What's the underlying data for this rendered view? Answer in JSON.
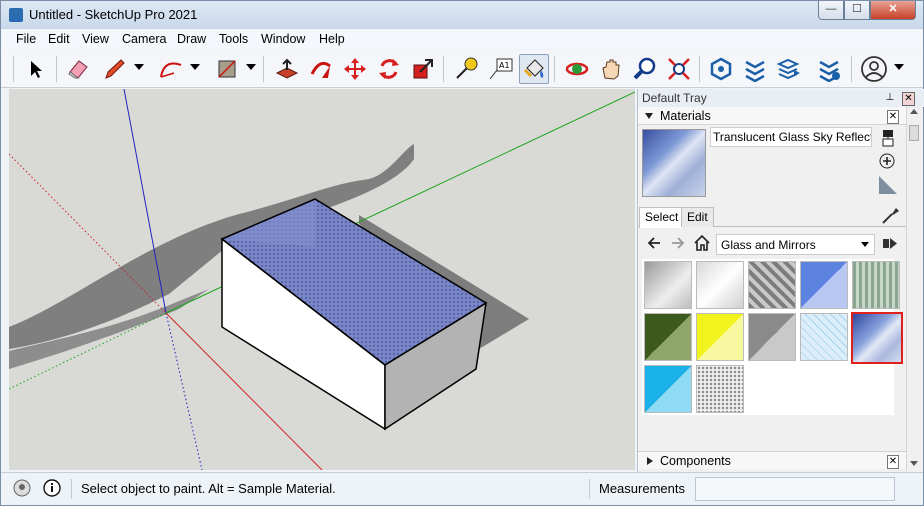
{
  "window": {
    "title": "Untitled - SketchUp Pro 2021",
    "min": "—",
    "max": "☐",
    "close": "✕"
  },
  "menu": [
    "File",
    "Edit",
    "View",
    "Camera",
    "Draw",
    "Tools",
    "Window",
    "Help"
  ],
  "toolbar": {
    "icons": [
      "select-icon",
      "eraser-icon",
      "pencil-icon",
      "arc-icon",
      "rectangle-icon",
      "push-pull-icon",
      "follow-me-icon",
      "move-icon",
      "rotate-icon",
      "scale-icon",
      "tape-measure-icon",
      "text-icon",
      "paint-bucket-icon",
      "orbit-icon",
      "pan-icon",
      "zoom-icon",
      "zoom-extents-icon",
      "extension-warehouse-icon",
      "3d-warehouse-icon",
      "layout-icon",
      "extension-manager-icon",
      "account-icon"
    ],
    "text_label": "A1",
    "active": "paint-bucket-icon"
  },
  "tray": {
    "title": "Default Tray",
    "pin": "⊥",
    "close": "✕",
    "materials": {
      "header": "Materials",
      "name": "Translucent Glass Sky Reflection",
      "tabs": [
        "Select",
        "Edit"
      ],
      "active_tab": "Select",
      "collection": "Glass and Mirrors",
      "selected_index": 9
    },
    "components": {
      "header": "Components"
    }
  },
  "swatches": [
    {
      "name": "swatch-glass-gray-gradient",
      "style": "linear-gradient(135deg,#9a9a9a,#eeeeee 60%,#bdbdbd)"
    },
    {
      "name": "swatch-glass-silver",
      "style": "linear-gradient(135deg,#d8d8d8,#ffffff 50%,#cfcfcf)"
    },
    {
      "name": "swatch-glass-block",
      "style": "repeating-linear-gradient(45deg,#7d7d7d 0 4px,#c9c9c9 4px 8px)"
    },
    {
      "name": "swatch-glass-blue",
      "style": "linear-gradient(135deg,#5c83e0 50%,#b8c8f2 50%)"
    },
    {
      "name": "swatch-glass-green-ribbed",
      "style": "repeating-linear-gradient(90deg,#8aa690 0 3px,#c7d8c9 3px 6px)"
    },
    {
      "name": "swatch-glass-dark-green",
      "style": "linear-gradient(135deg,#3c5a1c 50%,#8ea66a 50%)"
    },
    {
      "name": "swatch-glass-yellow",
      "style": "linear-gradient(135deg,#f2f21c 50%,#f8f8a0 50%)"
    },
    {
      "name": "swatch-glass-gray-tint",
      "style": "linear-gradient(135deg,#8a8a8a 50%,#c9c9c9 50%)"
    },
    {
      "name": "swatch-glass-light-blue-grid",
      "style": "repeating-linear-gradient(45deg,#dbeefa 0 5px,#a8d2ee 5px 6px)"
    },
    {
      "name": "swatch-translucent-glass-sky-reflection",
      "style": "linear-gradient(135deg,#2f45a0 0%,#8aa3dc 40%,#e2e8f6 55%,#aab9dd 75%,#d3dcef 100%)"
    },
    {
      "name": "swatch-glass-cyan",
      "style": "linear-gradient(135deg,#1ab0e8 50%,#8fdaf5 50%)"
    },
    {
      "name": "swatch-glass-frosted",
      "style": "radial-gradient(circle,#8a8a8a 1px,#f0f0f0 1.5px) 0 0/4px 4px"
    }
  ],
  "statusbar": {
    "message": "Select object to paint. Alt = Sample Material.",
    "measurements_label": "Measurements",
    "measurements_value": ""
  },
  "colors": {
    "viewport_bg": "#d9d9d6",
    "axis_red": "#d42020",
    "axis_green": "#1aa51a",
    "axis_blue": "#2020c0",
    "selection": "#e0201c"
  }
}
